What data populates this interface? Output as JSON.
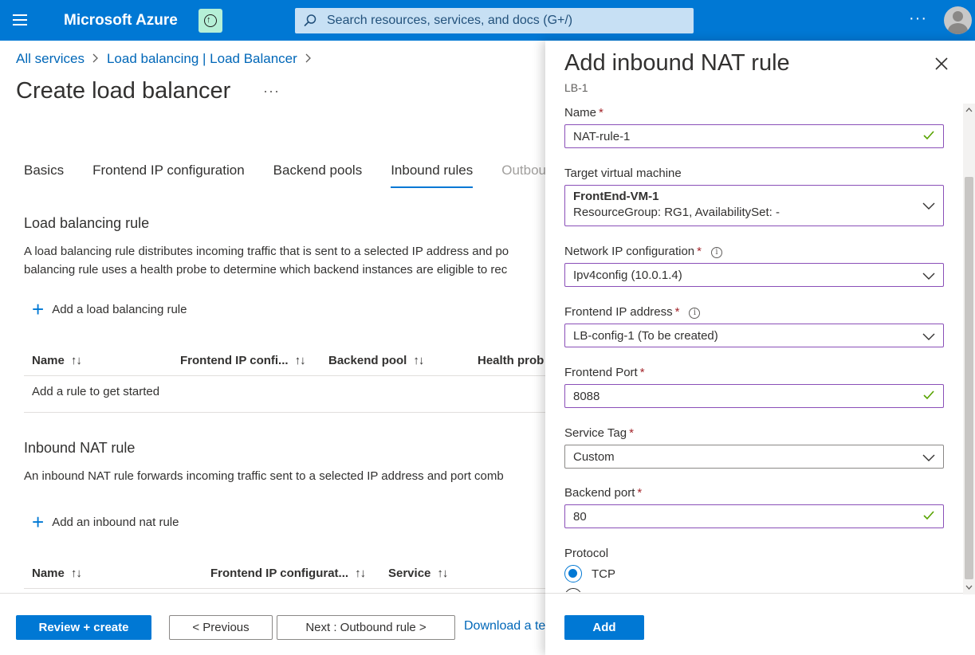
{
  "topbar": {
    "brand": "Microsoft Azure",
    "search_placeholder": "Search resources, services, and docs (G+/)",
    "more": "···",
    "color": "#0078d4"
  },
  "breadcrumb": {
    "items": [
      "All services",
      "Load balancing | Load Balancer"
    ],
    "separator": ">"
  },
  "page": {
    "title": "Create load balancer",
    "more": "···"
  },
  "tabs": [
    {
      "label": "Basics",
      "state": "normal"
    },
    {
      "label": "Frontend IP configuration",
      "state": "normal"
    },
    {
      "label": "Backend pools",
      "state": "normal"
    },
    {
      "label": "Inbound rules",
      "state": "active"
    },
    {
      "label": "Outbou",
      "state": "disabled"
    }
  ],
  "lb_rule": {
    "title": "Load balancing rule",
    "desc_line1": "A load balancing rule distributes incoming traffic that is sent to a selected IP address and po",
    "desc_line2": "balancing rule uses a health probe to determine which backend instances are eligible to rec",
    "add_label": "Add a load balancing rule",
    "columns": [
      "Name",
      "Frontend IP confi...",
      "Backend pool",
      "Health prob"
    ],
    "sort_glyph": "↑↓",
    "empty": "Add a rule to get started"
  },
  "nat_rule": {
    "title": "Inbound NAT rule",
    "desc": "An inbound NAT rule forwards incoming traffic sent to a selected IP address and port comb",
    "add_label": "Add an inbound nat rule",
    "columns": [
      "Name",
      "Frontend IP configurat...",
      "Service"
    ]
  },
  "footer": {
    "review": "Review + create",
    "previous": "< Previous",
    "next": "Next : Outbound rule >",
    "download": "Download a te"
  },
  "panel": {
    "title": "Add inbound NAT rule",
    "subtitle": "LB-1",
    "name_label": "Name",
    "name_value": "NAT-rule-1",
    "target_vm_label": "Target virtual machine",
    "target_vm_name": "FrontEnd-VM-1",
    "target_vm_meta": "ResourceGroup: RG1, AvailabilitySet: -",
    "nic_label": "Network IP configuration",
    "nic_value": "Ipv4config (10.0.1.4)",
    "frontend_ip_label": "Frontend IP address",
    "frontend_ip_value": "LB-config-1 (To be created)",
    "frontend_port_label": "Frontend Port",
    "frontend_port_value": "8088",
    "service_tag_label": "Service Tag",
    "service_tag_value": "Custom",
    "backend_port_label": "Backend port",
    "backend_port_value": "80",
    "protocol_label": "Protocol",
    "protocol_options": [
      "TCP",
      ""
    ],
    "protocol_selected": "TCP",
    "required_mark": "*",
    "info_glyph": "i",
    "add_button": "Add",
    "valid_color": "#57a300",
    "focus_border": "#8a4fb8"
  }
}
